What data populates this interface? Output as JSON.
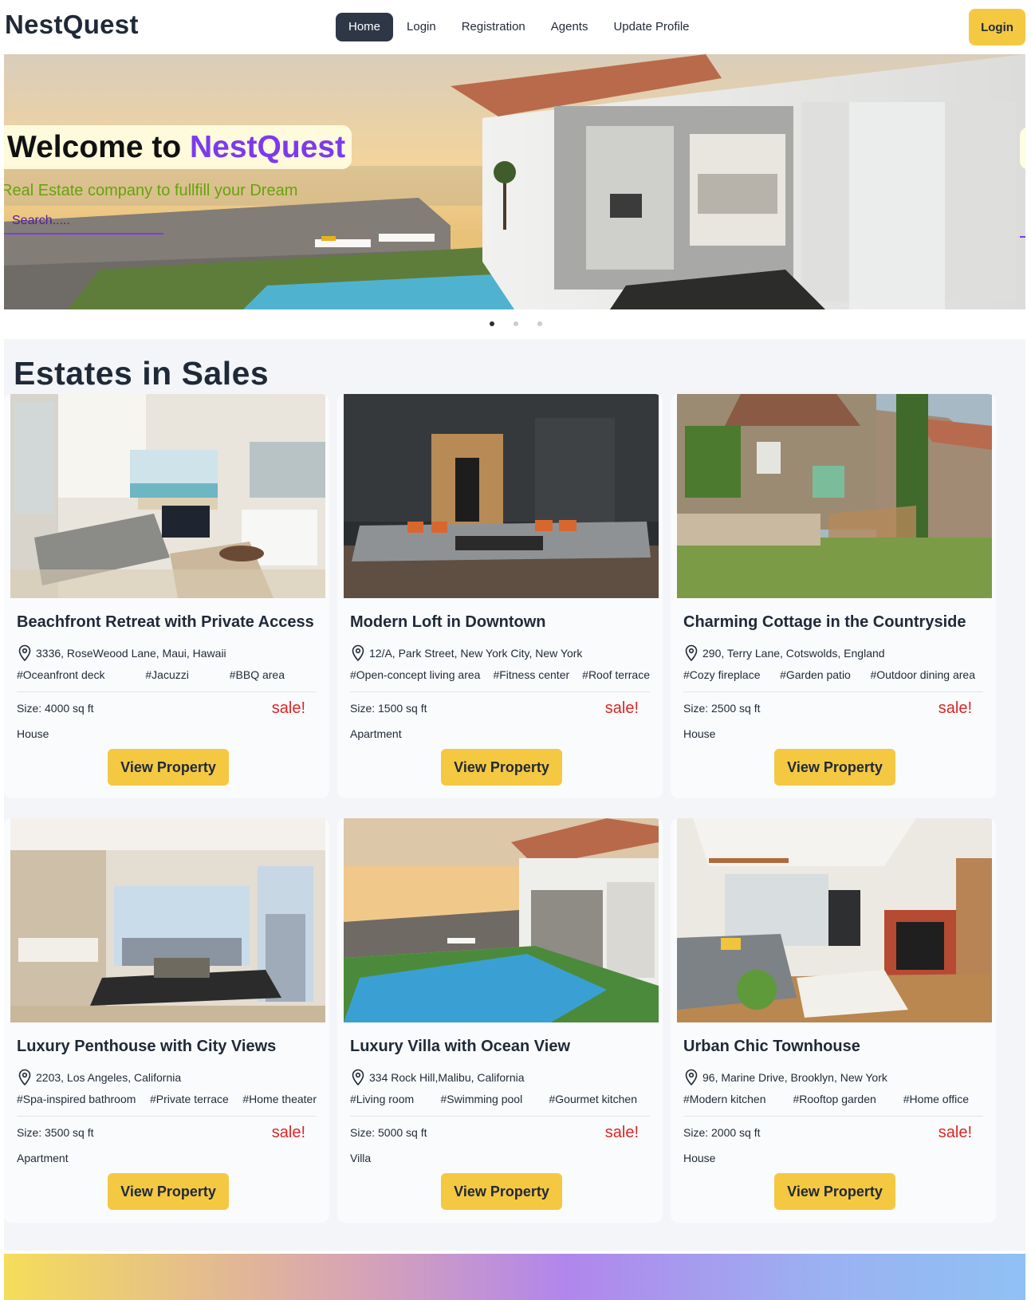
{
  "brand": "NestQuest",
  "nav": {
    "links": [
      "Home",
      "Login",
      "Registration",
      "Agents",
      "Update Profile"
    ],
    "active": "Home",
    "login_button": "Login"
  },
  "hero": {
    "welcome_prefix": "Welcome to",
    "welcome_brand": "NestQuest",
    "subtitle": "Real Estate company to fullfill your Dream",
    "search_placeholder": "Search.....",
    "slide_count": 3,
    "active_slide": 1
  },
  "sales": {
    "title": "Estates in Sales",
    "view_button": "View Property",
    "sale_badge": "sale!",
    "cards": [
      {
        "title": "Beachfront Retreat with Private Access",
        "location": "3336, RoseWeood Lane, Maui, Hawaii",
        "tags": [
          "#Oceanfront deck",
          "#Jacuzzi",
          "#BBQ area"
        ],
        "size": "Size: 4000 sq ft",
        "type": "House",
        "image": "beach-living-room-photo"
      },
      {
        "title": "Modern Loft in Downtown",
        "location": "12/A, Park Street, New York City, New York",
        "tags": [
          "#Open-concept living area",
          "#Fitness center",
          "#Roof terrace"
        ],
        "size": "Size: 1500 sq ft",
        "type": "Apartment",
        "image": "dark-loft-living-room-photo"
      },
      {
        "title": "Charming Cottage in the Countryside",
        "location": "290, Terry Lane, Cotswolds, England",
        "tags": [
          "#Cozy fireplace",
          "#Garden patio",
          "#Outdoor dining area"
        ],
        "size": "Size: 2500 sq ft",
        "type": "House",
        "image": "stone-cottage-photo"
      },
      {
        "title": "Luxury Penthouse with City Views",
        "location": "2203, Los Angeles, California",
        "tags": [
          "#Spa-inspired bathroom",
          "#Private terrace",
          "#Home theater"
        ],
        "size": "Size: 3500 sq ft",
        "type": "Apartment",
        "image": "penthouse-city-view-photo"
      },
      {
        "title": "Luxury Villa with Ocean View",
        "location": "334 Rock Hill,Malibu, California",
        "tags": [
          "#Living room",
          "#Swimming pool",
          "#Gourmet kitchen"
        ],
        "size": "Size: 5000 sq ft",
        "type": "Villa",
        "image": "villa-pool-sunset-photo"
      },
      {
        "title": "Urban Chic Townhouse",
        "location": "96, Marine Drive, Brooklyn, New York",
        "tags": [
          "#Modern kitchen",
          "#Rooftop garden",
          "#Home office"
        ],
        "size": "Size: 2000 sq ft",
        "type": "House",
        "image": "townhouse-fireplace-photo"
      }
    ]
  },
  "colors": {
    "accent_purple": "#7c3aed",
    "button_yellow": "#f5c842",
    "sale_red": "#dc2626",
    "subtitle_green": "#65a30d",
    "nav_active": "#2e3746"
  }
}
